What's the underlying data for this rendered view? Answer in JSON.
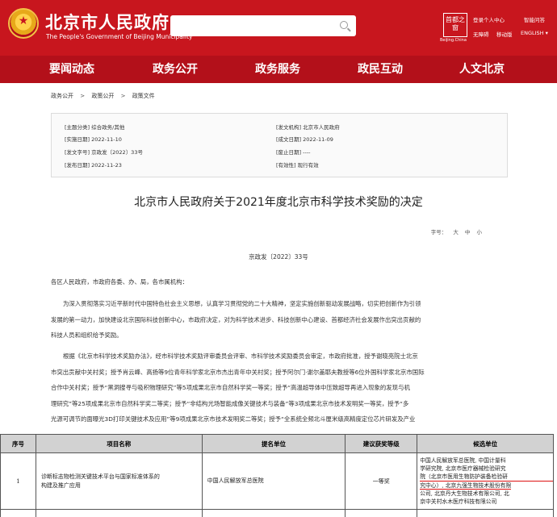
{
  "header": {
    "site_title": "北京市人民政府",
    "site_subtitle": "The People's Government of Beijing Municipality",
    "capital_logo": "首都之窗",
    "capital_logo_sub": "Beijing.China",
    "utils": {
      "login": "登录个人中心",
      "smart_qa": "智能问答",
      "accessible": "无障碍",
      "mobile": "移动版",
      "english": "ENGLISH"
    }
  },
  "nav": [
    "要闻动态",
    "政务公开",
    "政务服务",
    "政民互动",
    "人文北京"
  ],
  "breadcrumb": [
    "政务公开",
    "政策公开",
    "政策文件"
  ],
  "meta": {
    "theme": "[主题分类] 综合政务/其他",
    "issuer": "[发文机构] 北京市人民政府",
    "effective": "[实施日期] 2022-11-10",
    "written": "[成文日期] 2022-11-09",
    "docno": "[发文字号] 京政发〔2022〕33号",
    "repeal": "[废止日期] ----",
    "published": "[发布日期] 2022-11-23",
    "validity": "[有效性] 现行有效"
  },
  "document": {
    "title": "北京市人民政府关于2021年度北京市科学技术奖励的决定",
    "font_size_label": "字号：",
    "font_sizes": [
      "大",
      "中",
      "小"
    ],
    "number": "京政发〔2022〕33号",
    "salutation": "各区人民政府，市政府各委、办、局，各市属机构：",
    "para1": [
      "为深入贯彻落实习近平新时代中国特色社会主义思想，认真学习贯彻党的二十大精神，坚定实施创新驱动发展战略，切实把创新作为引领",
      "发展的第一动力，加快建设北京国际科技创新中心，市政府决定，对为科学技术进步、科技创新中心建设、首都经济社会发展作出突出贡献的",
      "科技人员和组织给予奖励。"
    ],
    "para2": [
      "根据《北京市科学技术奖励办法》，经市科学技术奖励评审委员会评审、市科学技术奖励委员会审定，市政府批准，授予谢晓亮院士北京",
      "市突出贡献中关村奖；授予肖云峰、高扬等9位青年科学家北京市杰出青年中关村奖；授予阿尔门·谢尔盖耶夫教授等6位外国科学家北京市国际",
      "合作中关村奖；授予“黑洞搜寻与吸积物理研究”等5项成果北京市自然科学奖一等奖；授予“高温超导体中压致超导再进入现象的发现与机",
      "理研究”等25项成果北京市自然科学奖二等奖；授予“非结构光场智能成像关键技术与装备”等3项成果北京市技术发明奖一等奖，授予“多",
      "光源可调节的面曝光3D打印关键技术及应用”等9项成果北京市技术发明奖二等奖；授予“全系统全频北斗厘米级高精度定位芯片研发及产业"
    ]
  },
  "table": {
    "headers": [
      "序号",
      "项目名称",
      "提名单位",
      "建议获奖等级",
      "候选单位"
    ],
    "row": {
      "index": "1",
      "project": [
        "诊断标志物检测关键技术平台与国家标准体系的",
        "构建及推广应用"
      ],
      "nominator": "中国人民解放军总医院",
      "level": "一等奖",
      "units": [
        "中国人民解放军总医院, 中国计量科",
        "学研究院, 北京市医疗器械检验研究",
        "院（北京市医用生物防护装备检验研",
        "究中心）, 北京九强生物技术股份有限",
        "公司, 北京丹大生物技术有限公司, 北",
        "京中关村水木医疗科技有限公司"
      ]
    }
  }
}
